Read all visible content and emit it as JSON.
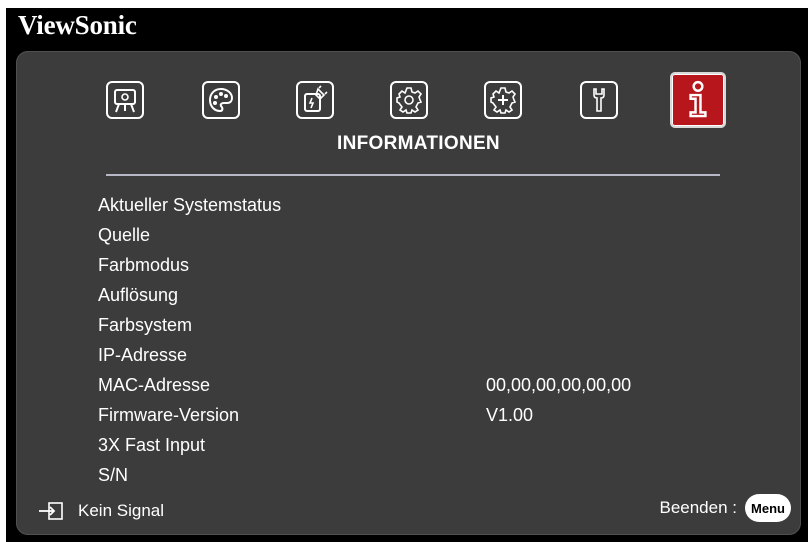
{
  "brand": "ViewSonic",
  "menu_tabs": [
    {
      "name": "display",
      "icon": "display-projector-icon"
    },
    {
      "name": "image",
      "icon": "palette-icon"
    },
    {
      "name": "power",
      "icon": "power-plug-icon"
    },
    {
      "name": "basic",
      "icon": "gear-icon"
    },
    {
      "name": "advanced",
      "icon": "gear-plus-icon"
    },
    {
      "name": "system",
      "icon": "wrench-icon"
    },
    {
      "name": "information",
      "icon": "info-icon",
      "active": true
    }
  ],
  "section_title": "INFORMATIONEN",
  "info_rows": [
    {
      "label": "Aktueller Systemstatus",
      "value": ""
    },
    {
      "label": "Quelle",
      "value": ""
    },
    {
      "label": "Farbmodus",
      "value": ""
    },
    {
      "label": "Auflösung",
      "value": ""
    },
    {
      "label": "Farbsystem",
      "value": ""
    },
    {
      "label": "IP-Adresse",
      "value": ""
    },
    {
      "label": "MAC-Adresse",
      "value": "00,00,00,00,00,00"
    },
    {
      "label": "Firmware-Version",
      "value": "V1.00"
    },
    {
      "label": "3X Fast Input",
      "value": ""
    },
    {
      "label": "S/N",
      "value": ""
    }
  ],
  "footer": {
    "signal_icon": "input-source-icon",
    "signal_text": "Kein Signal",
    "exit_label": "Beenden :",
    "menu_button": "Menu"
  },
  "colors": {
    "panel": "#3c3c3c",
    "active_tab": "#b7161c",
    "text": "#ffffff"
  }
}
